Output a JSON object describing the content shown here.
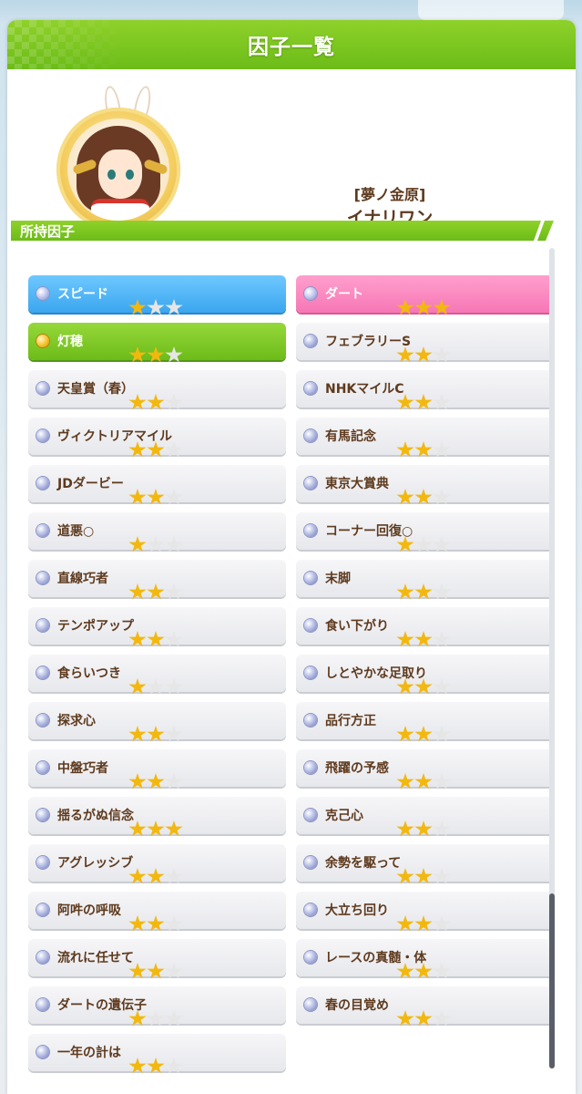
{
  "dialog": {
    "title": "因子一覧"
  },
  "character": {
    "epithet": "[夢ノ金原]",
    "name": "イナリワン"
  },
  "section": {
    "title": "所持因子"
  },
  "colors": {
    "header_green": "#7cc623",
    "blue_factor": "#3aa6ee",
    "pink_factor": "#f677b5",
    "green_factor": "#6cbc18",
    "star_on": "#f2b810",
    "text_brown": "#5e3a1e"
  },
  "factors_left": [
    {
      "name": "スピード",
      "stars": 1,
      "style": "blue",
      "orb": "blue-orb-icon"
    },
    {
      "name": "灯穂",
      "stars": 2,
      "style": "green",
      "orb": "gold-orb-icon"
    },
    {
      "name": "天皇賞（春）",
      "stars": 2,
      "style": "white",
      "orb": "blue-orb-icon"
    },
    {
      "name": "ヴィクトリアマイル",
      "stars": 2,
      "style": "white",
      "orb": "blue-orb-icon"
    },
    {
      "name": "JDダービー",
      "stars": 2,
      "style": "white",
      "orb": "blue-orb-icon"
    },
    {
      "name": "道悪○",
      "stars": 1,
      "style": "white",
      "orb": "blue-orb-icon"
    },
    {
      "name": "直線巧者",
      "stars": 2,
      "style": "white",
      "orb": "blue-orb-icon"
    },
    {
      "name": "テンポアップ",
      "stars": 2,
      "style": "white",
      "orb": "blue-orb-icon"
    },
    {
      "name": "食らいつき",
      "stars": 1,
      "style": "white",
      "orb": "blue-orb-icon"
    },
    {
      "name": "探求心",
      "stars": 2,
      "style": "white",
      "orb": "blue-orb-icon"
    },
    {
      "name": "中盤巧者",
      "stars": 2,
      "style": "white",
      "orb": "blue-orb-icon"
    },
    {
      "name": "揺るがぬ信念",
      "stars": 3,
      "style": "white",
      "orb": "blue-orb-icon"
    },
    {
      "name": "アグレッシブ",
      "stars": 2,
      "style": "white",
      "orb": "blue-orb-icon"
    },
    {
      "name": "阿吽の呼吸",
      "stars": 2,
      "style": "white",
      "orb": "blue-orb-icon"
    },
    {
      "name": "流れに任せて",
      "stars": 2,
      "style": "white",
      "orb": "blue-orb-icon"
    },
    {
      "name": "ダートの遺伝子",
      "stars": 1,
      "style": "white",
      "orb": "blue-orb-icon"
    },
    {
      "name": "一年の計は",
      "stars": 2,
      "style": "white",
      "orb": "blue-orb-icon"
    }
  ],
  "factors_right": [
    {
      "name": "ダート",
      "stars": 3,
      "style": "pink",
      "orb": "blue-orb-icon"
    },
    {
      "name": "フェブラリーS",
      "stars": 2,
      "style": "white",
      "orb": "blue-orb-icon"
    },
    {
      "name": "NHKマイルC",
      "stars": 2,
      "style": "white",
      "orb": "blue-orb-icon"
    },
    {
      "name": "有馬記念",
      "stars": 2,
      "style": "white",
      "orb": "blue-orb-icon"
    },
    {
      "name": "東京大賞典",
      "stars": 2,
      "style": "white",
      "orb": "blue-orb-icon"
    },
    {
      "name": "コーナー回復○",
      "stars": 1,
      "style": "white",
      "orb": "blue-orb-icon"
    },
    {
      "name": "末脚",
      "stars": 2,
      "style": "white",
      "orb": "blue-orb-icon"
    },
    {
      "name": "食い下がり",
      "stars": 2,
      "style": "white",
      "orb": "blue-orb-icon"
    },
    {
      "name": "しとやかな足取り",
      "stars": 2,
      "style": "white",
      "orb": "blue-orb-icon"
    },
    {
      "name": "品行方正",
      "stars": 2,
      "style": "white",
      "orb": "blue-orb-icon"
    },
    {
      "name": "飛躍の予感",
      "stars": 2,
      "style": "white",
      "orb": "blue-orb-icon"
    },
    {
      "name": "克己心",
      "stars": 2,
      "style": "white",
      "orb": "blue-orb-icon"
    },
    {
      "name": "余勢を駆って",
      "stars": 2,
      "style": "white",
      "orb": "blue-orb-icon"
    },
    {
      "name": "大立ち回り",
      "stars": 2,
      "style": "white",
      "orb": "blue-orb-icon"
    },
    {
      "name": "レースの真髄・体",
      "stars": 2,
      "style": "white",
      "orb": "blue-orb-icon"
    },
    {
      "name": "春の目覚め",
      "stars": 2,
      "style": "white",
      "orb": "blue-orb-icon"
    }
  ],
  "max_stars": 3
}
